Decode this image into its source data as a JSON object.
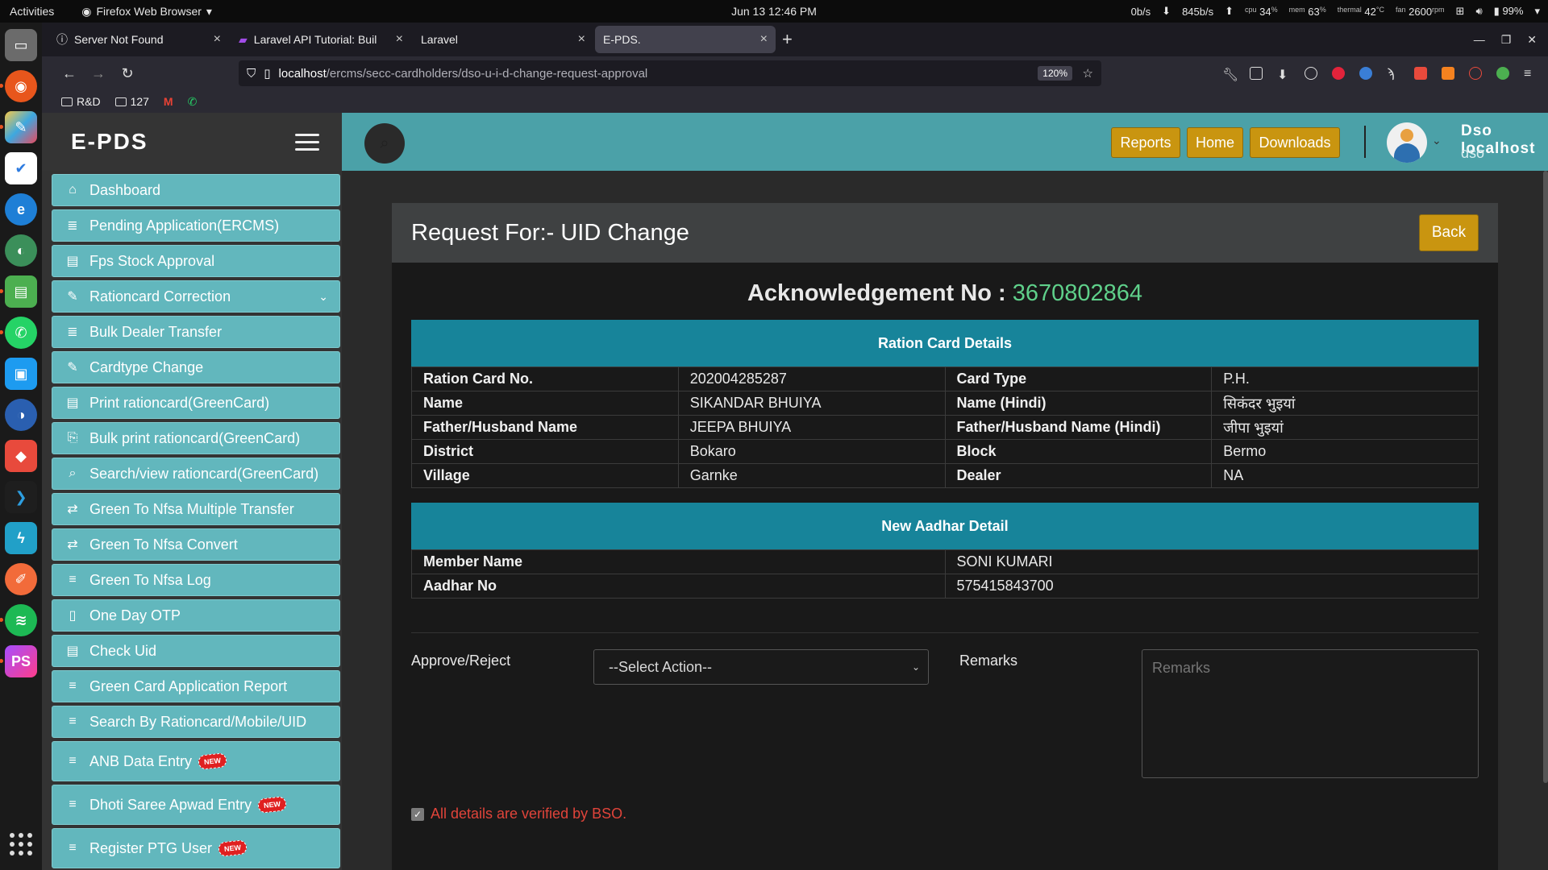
{
  "system": {
    "activities": "Activities",
    "app_name": "Firefox Web Browser",
    "clock": "Jun 13  12:46 PM",
    "net_down": "0b/s",
    "net_up": "845b/s",
    "cpu": "34",
    "mem": "63",
    "temp": "42",
    "fan": "2600",
    "battery": "99%"
  },
  "browser": {
    "tabs": [
      {
        "title": "Server Not Found",
        "icon": "info-icon"
      },
      {
        "title": "Laravel API Tutorial: Buil",
        "icon": "laravel-icon"
      },
      {
        "title": "Laravel",
        "icon": ""
      },
      {
        "title": "E-PDS.",
        "icon": ""
      }
    ],
    "url_host": "localhost",
    "url_path": "/ercms/secc-cardholders/dso-u-i-d-change-request-approval",
    "zoom": "120%",
    "bookmarks": [
      "R&D",
      "127"
    ]
  },
  "app": {
    "brand": "E-PDS",
    "menu": [
      {
        "label": "Dashboard",
        "icon": "⌂"
      },
      {
        "label": "Pending Application(ERCMS)",
        "icon": "≣"
      },
      {
        "label": "Fps Stock Approval",
        "icon": "▤"
      },
      {
        "label": "Rationcard Correction",
        "icon": "✎"
      },
      {
        "label": "Bulk Dealer Transfer",
        "icon": "≣"
      },
      {
        "label": "Cardtype Change",
        "icon": "✎"
      },
      {
        "label": "Print rationcard(GreenCard)",
        "icon": "▤"
      },
      {
        "label": "Bulk print rationcard(GreenCard)",
        "icon": "⎘"
      },
      {
        "label": "Search/view rationcard(GreenCard)",
        "icon": "⌕"
      },
      {
        "label": "Green To Nfsa Multiple Transfer",
        "icon": "⇄"
      },
      {
        "label": "Green To Nfsa Convert",
        "icon": "⇄"
      },
      {
        "label": "Green To Nfsa Log",
        "icon": "≡"
      },
      {
        "label": "One Day OTP",
        "icon": "▯"
      },
      {
        "label": "Check Uid",
        "icon": "▤"
      },
      {
        "label": "Green Card Application Report",
        "icon": "≡"
      },
      {
        "label": "Search By Rationcard/Mobile/UID",
        "icon": "≡"
      },
      {
        "label": "ANB Data Entry",
        "icon": "≡"
      },
      {
        "label": "Dhoti Saree Apwad Entry",
        "icon": "≡"
      },
      {
        "label": "Register PTG User",
        "icon": "≡"
      }
    ],
    "new_badge": "NEW",
    "header_buttons": {
      "reports": "Reports",
      "home": "Home",
      "downloads": "Downloads"
    },
    "user_name": "Dso  localhost",
    "user_role": "dso"
  },
  "content": {
    "title": "Request For:- UID Change",
    "back": "Back",
    "ack_label": "Acknowledgement No :",
    "ack_number": "3670802864",
    "ration_header": "Ration Card Details",
    "ration_rows": [
      [
        "Ration Card No.",
        "202004285287",
        "Card Type",
        "P.H."
      ],
      [
        "Name",
        "SIKANDAR BHUIYA",
        "Name (Hindi)",
        "सिकंदर भुइयां"
      ],
      [
        "Father/Husband Name",
        "JEEPA BHUIYA",
        "Father/Husband Name (Hindi)",
        "जीपा भुइयां"
      ],
      [
        "District",
        "Bokaro",
        "Block",
        "Bermo"
      ],
      [
        "Village",
        "Garnke",
        "Dealer",
        "NA"
      ]
    ],
    "aadhar_header": "New Aadhar Detail",
    "aadhar_rows": [
      [
        "Member Name",
        "SONI KUMARI"
      ],
      [
        "Aadhar No",
        "575415843700"
      ]
    ],
    "approve_label": "Approve/Reject",
    "select_value": "--Select Action--",
    "remarks_label": "Remarks",
    "remarks_placeholder": "Remarks",
    "verify_text": "All details are verified by BSO."
  }
}
